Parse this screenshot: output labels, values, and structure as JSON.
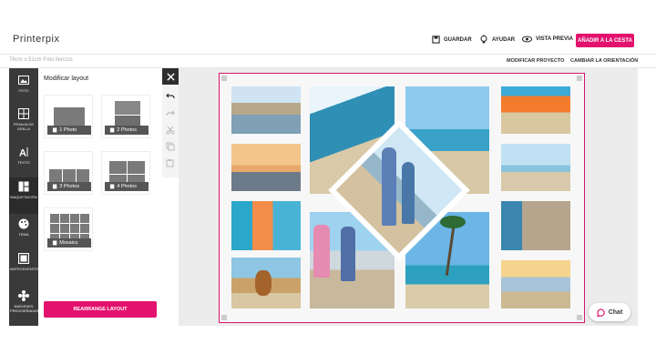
{
  "header": {
    "logo": "Printerpix",
    "save_label": "GUARDAR",
    "help_label": "AYUDAR",
    "preview_label": "VISTA PREVIA",
    "cart_label": "AÑADIR A LA CESTA"
  },
  "subheader": {
    "product_size": "76cm x 51cm Foto lienzos",
    "modify_project": "MODIFICAR PROYECTO",
    "change_orientation": "CAMBIAR LA ORIENTACIÓN"
  },
  "sidebar": {
    "items": [
      {
        "label": "FOTO",
        "icon": "image-icon"
      },
      {
        "label": "FRANJA DE GRILLA",
        "icon": "grid-strip-icon"
      },
      {
        "label": "TEXTO",
        "icon": "text-icon"
      },
      {
        "label": "MAQUETACIÓN",
        "icon": "layout-icon"
      },
      {
        "label": "TEMA",
        "icon": "palette-icon"
      },
      {
        "label": "ANTECEDENTES",
        "icon": "background-icon"
      },
      {
        "label": "IMÁGENES PREDISEÑADAS",
        "icon": "clipart-icon"
      }
    ]
  },
  "panel": {
    "title": "Modificar layout",
    "layouts": [
      {
        "label": "1 Photo"
      },
      {
        "label": "2 Photos"
      },
      {
        "label": "3 Photos"
      },
      {
        "label": "4 Photos"
      },
      {
        "label": "Mosaics"
      }
    ],
    "rearrange_label": "REARRANGE LAYOUT"
  },
  "chat": {
    "label": "Chat"
  },
  "colors": {
    "accent": "#e2126e",
    "sidebar": "#3a3a3a"
  }
}
